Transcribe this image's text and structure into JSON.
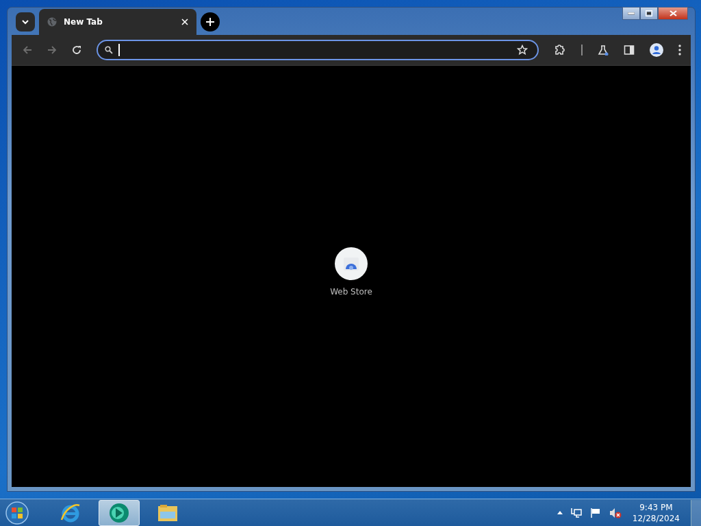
{
  "browser": {
    "tabs": [
      {
        "title": "New Tab",
        "selected": true
      }
    ]
  },
  "new_tab_page": {
    "shortcuts": [
      {
        "label": "Web Store"
      }
    ]
  },
  "taskbar": {
    "apps": [
      {
        "kind": "ie",
        "selected": false
      },
      {
        "kind": "chrome",
        "selected": true
      },
      {
        "kind": "folder",
        "selected": false
      }
    ],
    "clock": {
      "time": "9:43 PM",
      "date": "12/28/2024"
    }
  }
}
